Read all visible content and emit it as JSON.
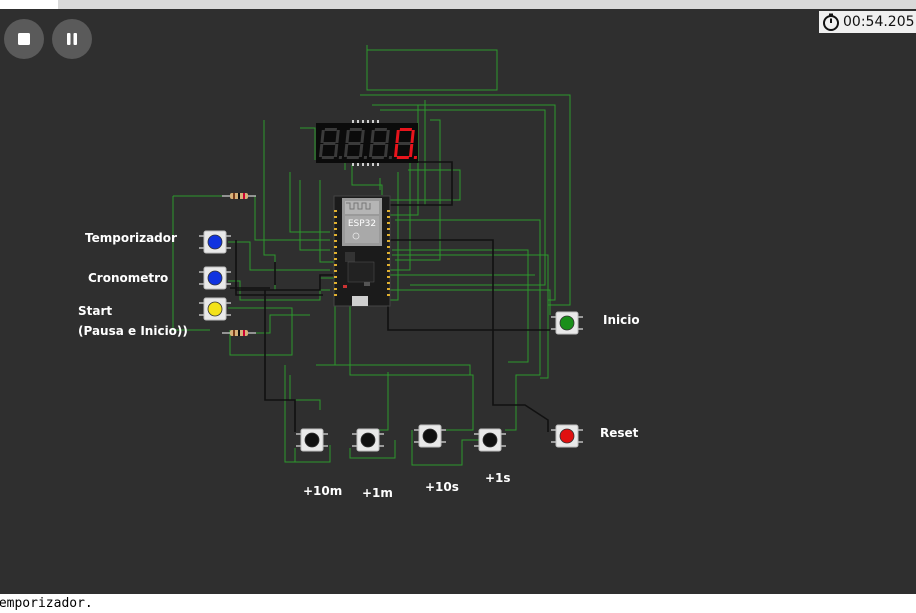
{
  "simulator": {
    "stop_icon": "stop-icon",
    "pause_icon": "pause-icon",
    "timer_icon": "stopwatch-icon",
    "elapsed_time": "00:54.205"
  },
  "display": {
    "type": "4-digit-7-segment",
    "digits": [
      "8",
      "8",
      "8",
      "0"
    ],
    "lit_digit_index": 3,
    "lit_color": "#e8141c",
    "unlit_color": "#3a3a3a"
  },
  "board": {
    "chip_label": "ESP32"
  },
  "buttons": [
    {
      "label": "Temporizador",
      "color": "#1033e0"
    },
    {
      "label": "Cronometro",
      "color": "#1033e0"
    },
    {
      "label": "Start",
      "label2": "(Pausa e Inicio))",
      "color": "#f3e21a"
    },
    {
      "label": "Inicio",
      "color": "#1a8f1a"
    },
    {
      "label": "Reset",
      "color": "#e01010"
    },
    {
      "label": "+10m",
      "color": "#111111"
    },
    {
      "label": "+1m",
      "color": "#111111"
    },
    {
      "label": "+10s",
      "color": "#111111"
    },
    {
      "label": "+1s",
      "color": "#111111"
    }
  ],
  "wire_color": "#2c9a2c",
  "console": {
    "text": "Temporizador."
  }
}
